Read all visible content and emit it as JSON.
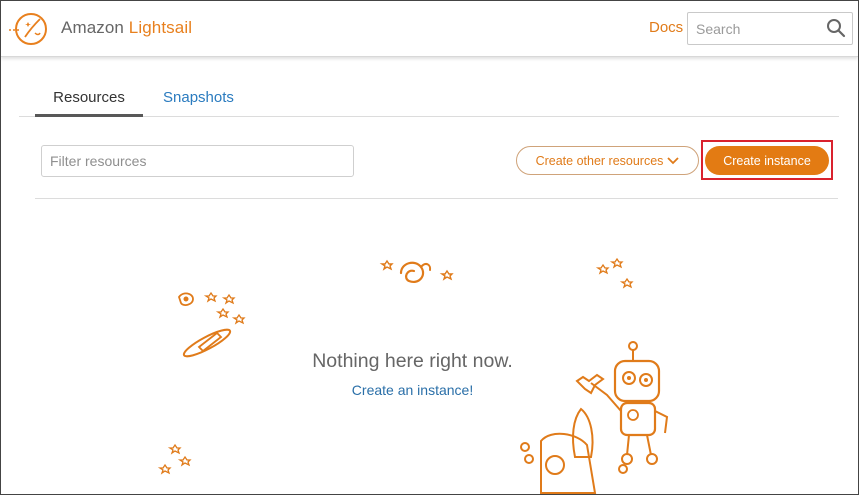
{
  "header": {
    "brand_prefix": "Amazon",
    "brand_name": "Lightsail",
    "docs_label": "Docs",
    "search_placeholder": "Search",
    "icons": [
      "lightsail-logo",
      "search-icon"
    ]
  },
  "tabs": [
    {
      "label": "Resources",
      "active": true
    },
    {
      "label": "Snapshots",
      "active": false
    }
  ],
  "toolbar": {
    "filter_placeholder": "Filter resources",
    "create_other_label": "Create other resources",
    "create_instance_label": "Create instance"
  },
  "empty_state": {
    "message": "Nothing here right now.",
    "link_label": "Create an instance!"
  },
  "colors": {
    "accent": "#e37b13",
    "link": "#2a7bbf",
    "highlight_box": "#d9222e"
  }
}
